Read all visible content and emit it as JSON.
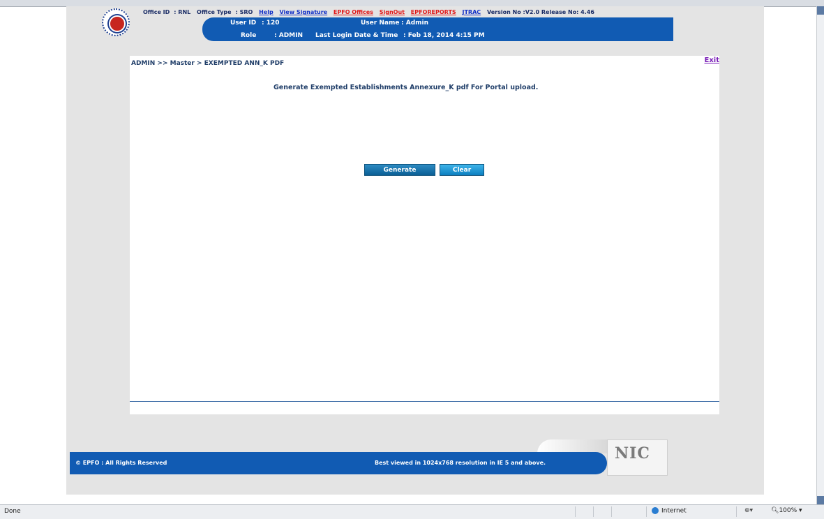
{
  "header": {
    "office_id_label": "Office ID",
    "office_id_value": ": RNL",
    "office_type_label": "Office Type",
    "office_type_value": ": SRO",
    "links": {
      "help": "Help",
      "view_signature": "View Signature",
      "epfo_offices": "EPFO Offices",
      "sign_out": "SignOut",
      "epfo_reports": "EPFOREPORTS",
      "jtrac": "JTRAC"
    },
    "version": "Version No :V2.0 Release No: 4.46",
    "user_id_label": "User ID",
    "user_id_value": ": 120",
    "user_name_label": "User Name",
    "user_name_value": ": Admin",
    "role_label": "Role",
    "role_value": ": ADMIN",
    "last_login_label": "Last Login Date & Time",
    "last_login_value": ": Feb 18, 2014 4:15 PM"
  },
  "content": {
    "breadcrumb": "ADMIN >> Master > EXEMPTED ANN_K PDF",
    "exit": "Exit",
    "title": "Generate Exempted Establishments Annexure_K pdf For Portal upload.",
    "generate_button": "Generate",
    "clear_button": "Clear"
  },
  "footer": {
    "copyright": "© EPFO : All Rights Reserved",
    "best_viewed": "Best viewed in 1024x768 resolution in IE 5 and above.",
    "nic_logo": "NIC"
  },
  "status_bar": {
    "done": "Done",
    "zone": "Internet",
    "zoom": "100%"
  },
  "colors": {
    "header_band": "#115bb3",
    "button": "#0a5f95",
    "link_red": "#e11818",
    "link_blue": "#1230c7",
    "exit_link": "#7a1fb7"
  }
}
